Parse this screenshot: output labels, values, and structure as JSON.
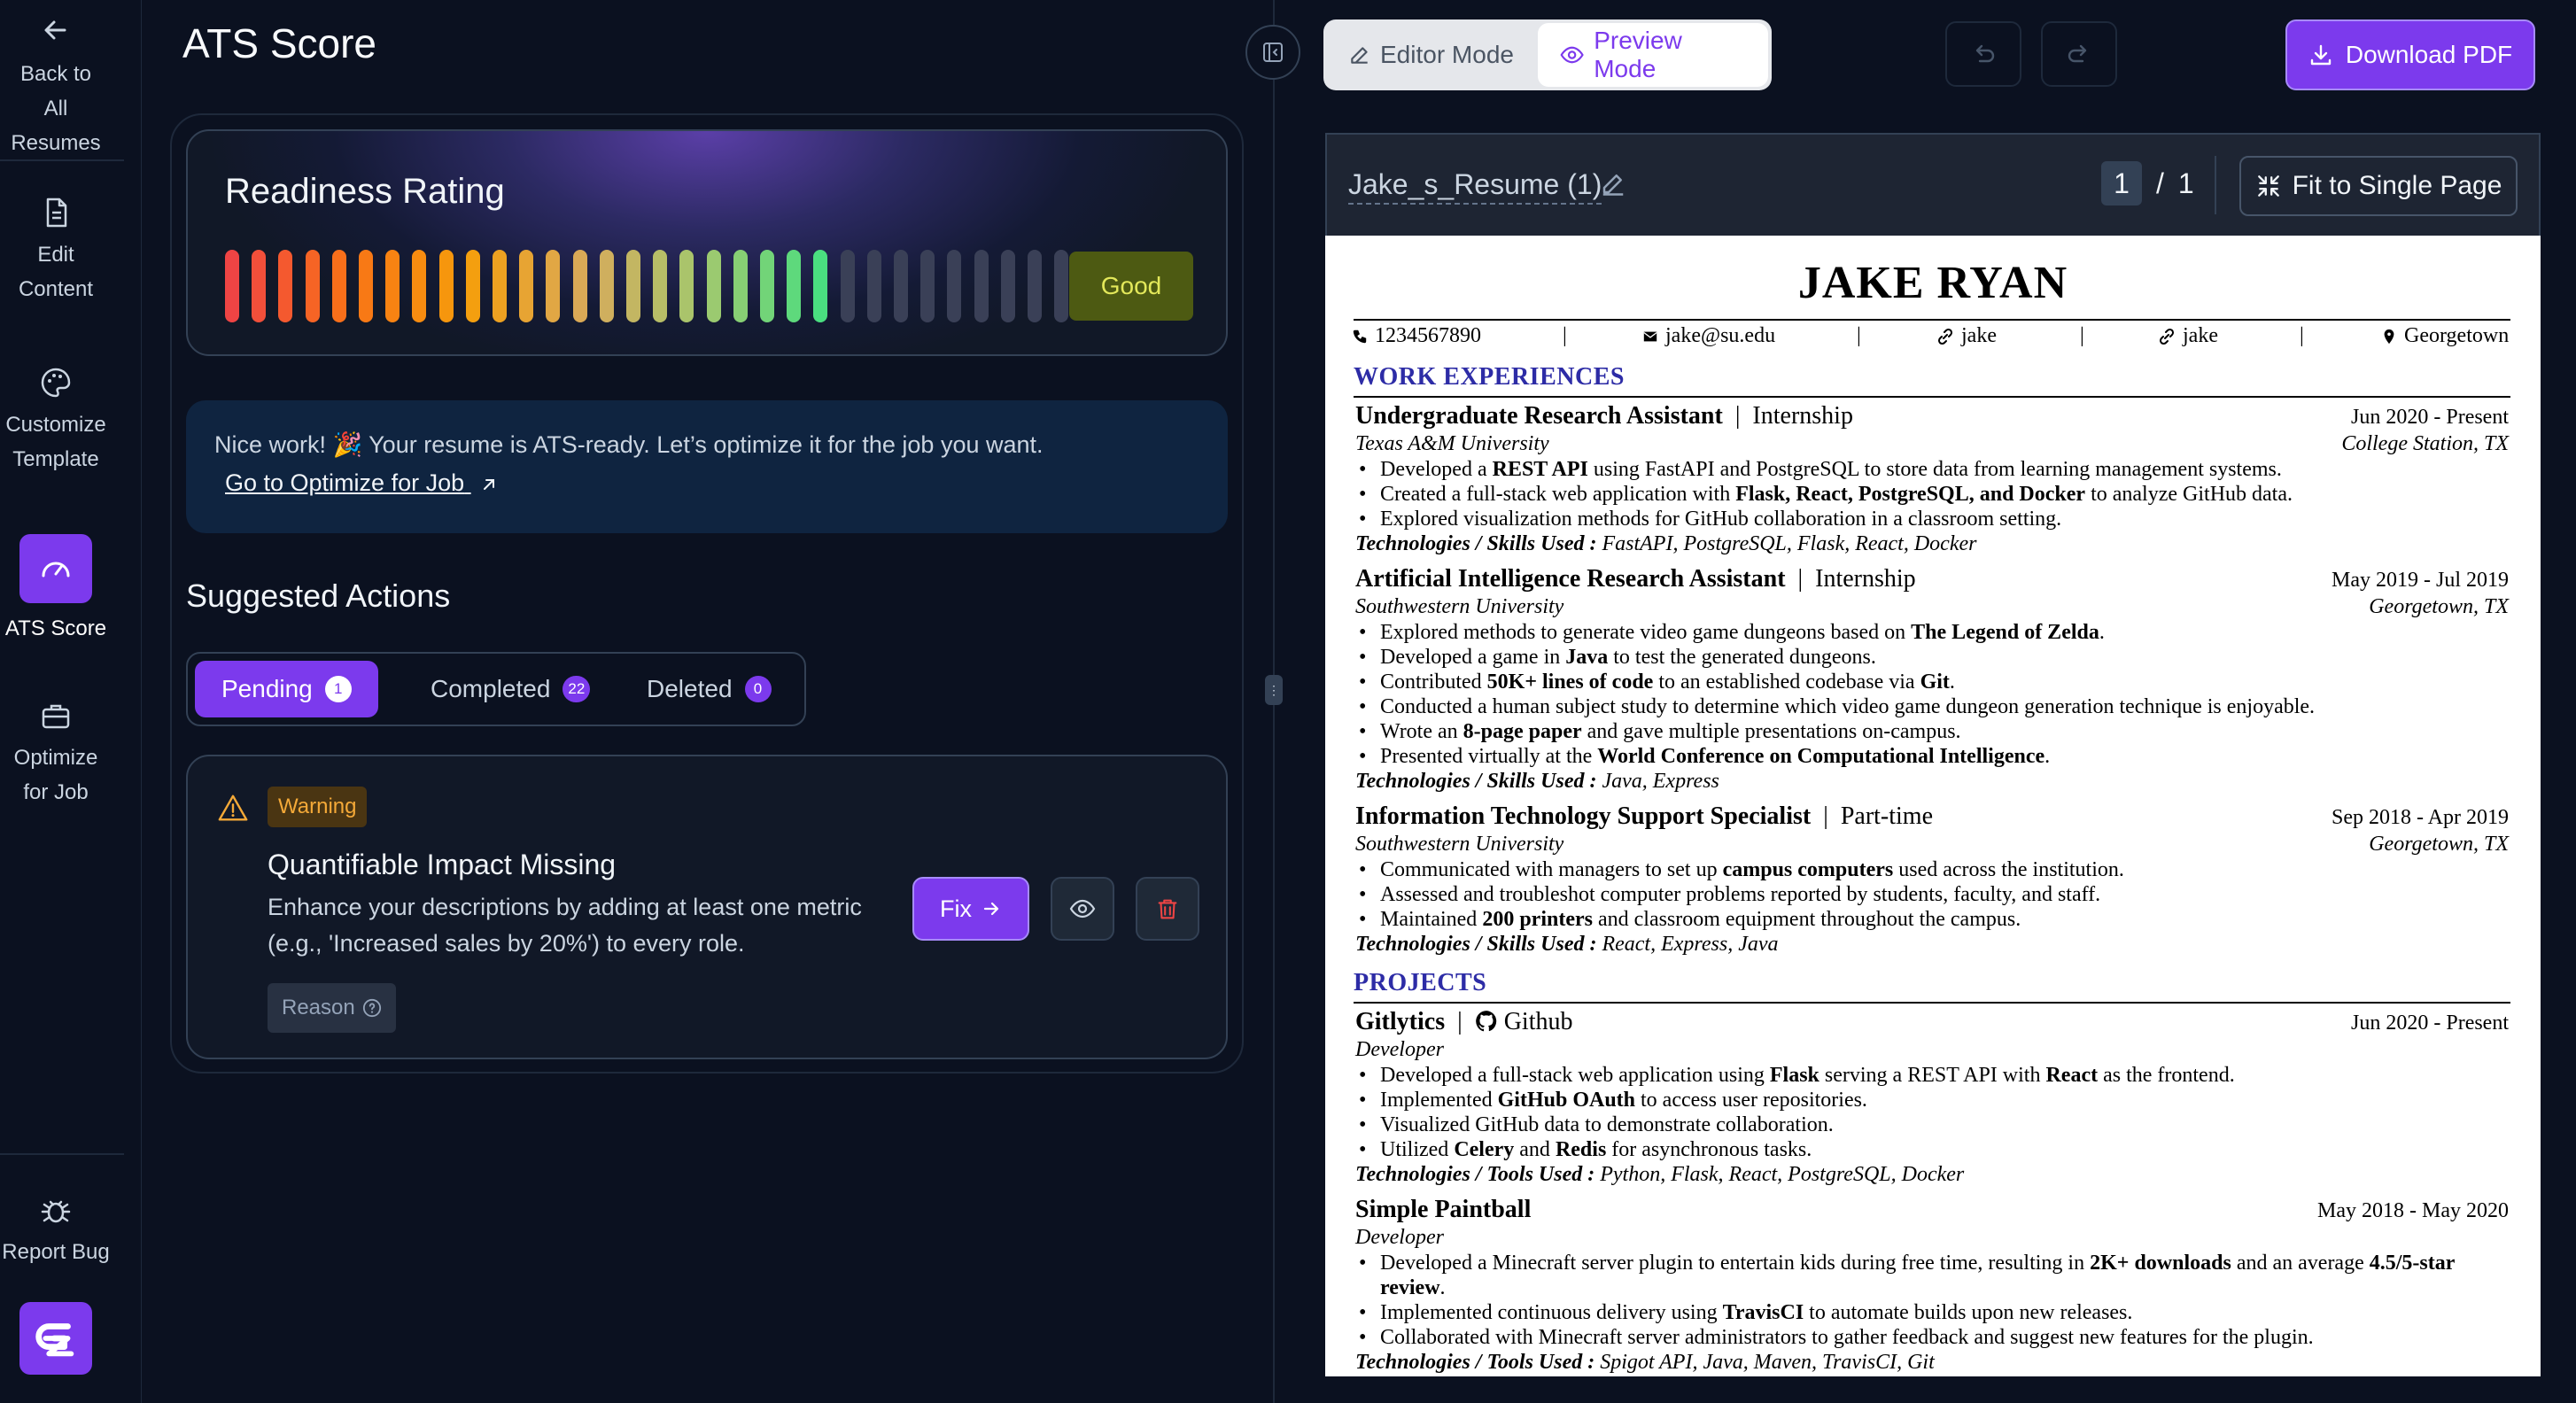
{
  "sidebar": {
    "back_line1": "Back to",
    "back_line2": "All Resumes",
    "edit_line1": "Edit",
    "edit_line2": "Content",
    "customize_line1": "Customize",
    "customize_line2": "Template",
    "ats": "ATS Score",
    "optimize_line1": "Optimize",
    "optimize_line2": "for Job",
    "report": "Report Bug",
    "logo": "Ꮚ"
  },
  "page_title": "ATS Score",
  "readiness": {
    "title": "Readiness Rating",
    "rating": "Good",
    "total_bars": 32,
    "filled_bars": 23
  },
  "info": {
    "message": "Nice work! 🎉 Your resume is ATS-ready. Let’s optimize it for the job you want.",
    "link": "Go to Optimize for Job"
  },
  "suggested": {
    "title": "Suggested Actions",
    "tabs": [
      {
        "label": "Pending",
        "count": "1"
      },
      {
        "label": "Completed",
        "count": "22"
      },
      {
        "label": "Deleted",
        "count": "0"
      }
    ],
    "item": {
      "badge": "Warning",
      "title": "Quantifiable Impact Missing",
      "desc1": "Enhance your descriptions by adding at least one metric",
      "desc2": "(e.g., 'Increased sales by 20%') to every role.",
      "reason": "Reason",
      "fix": "Fix"
    }
  },
  "toolbar": {
    "editor_mode": "Editor Mode",
    "preview_mode": "Preview Mode",
    "download": "Download PDF"
  },
  "doc": {
    "name": "Jake_s_Resume (1)",
    "page_current": "1",
    "page_sep": "/",
    "page_total": "1",
    "fit": "Fit to Single Page"
  },
  "resume": {
    "name": "JAKE RYAN",
    "phone": "1234567890",
    "email": "jake@su.edu",
    "link1": "jake",
    "link2": "jake",
    "location": "Georgetown",
    "sep": "|",
    "work_title": "WORK EXPERIENCES",
    "projects_title": "PROJECTS",
    "work": [
      {
        "title": "Undergraduate Research Assistant",
        "type": "Internship",
        "date": "Jun 2020 - Present",
        "org": "Texas A&M University",
        "loc": "College Station, TX",
        "bullets": [
          [
            "Developed a ",
            "REST API",
            " using FastAPI and PostgreSQL to store data from learning management systems."
          ],
          [
            "Created a full-stack web application with ",
            "Flask, React, PostgreSQL, and Docker",
            " to analyze GitHub data."
          ],
          [
            "Explored visualization methods for GitHub collaboration in a classroom setting.",
            "",
            ""
          ]
        ],
        "tech_label": "Technologies / Skills Used :",
        "tech": "FastAPI, PostgreSQL, Flask, React, Docker"
      },
      {
        "title": "Artificial Intelligence Research Assistant",
        "type": "Internship",
        "date": "May 2019 - Jul 2019",
        "org": "Southwestern University",
        "loc": "Georgetown, TX",
        "bullets": [
          [
            "Explored methods to generate video game dungeons based on ",
            "The Legend of Zelda",
            "."
          ],
          [
            "Developed a game in ",
            "Java",
            " to test the generated dungeons."
          ],
          [
            "Contributed ",
            "50K+ lines of code",
            " to an established codebase via "
          ],
          [
            "Conducted a human subject study to determine which video game dungeon generation technique is enjoyable.",
            "",
            ""
          ],
          [
            "Wrote an ",
            "8-page paper",
            " and gave multiple presentations on-campus."
          ],
          [
            "Presented virtually at the ",
            "World Conference on Computational Intelligence",
            "."
          ]
        ],
        "git": "Git",
        "tech_label": "Technologies / Skills Used :",
        "tech": "Java, Express"
      },
      {
        "title": "Information Technology Support Specialist",
        "type": "Part-time",
        "date": "Sep 2018 - Apr 2019",
        "org": "Southwestern University",
        "loc": "Georgetown, TX",
        "bullets": [
          [
            "Communicated with managers to set up ",
            "campus computers",
            " used across the institution."
          ],
          [
            "Assessed and troubleshot computer problems reported by students, faculty, and staff.",
            "",
            ""
          ],
          [
            "Maintained ",
            "200 printers",
            " and classroom equipment throughout the campus."
          ]
        ],
        "tech_label": "Technologies / Skills Used :",
        "tech": "React, Express, Java"
      }
    ],
    "projects": [
      {
        "title": "Gitlytics",
        "link": "Github",
        "date": "Jun 2020 - Present",
        "role": "Developer",
        "bullets": [
          [
            "Developed a full-stack web application using ",
            "Flask",
            " serving a REST API with ",
            "React",
            " as the frontend."
          ],
          [
            "Implemented ",
            "GitHub OAuth",
            " to access user repositories.",
            "",
            ""
          ],
          [
            "Visualized GitHub data to demonstrate collaboration.",
            "",
            "",
            "",
            ""
          ],
          [
            "Utilized ",
            "Celery",
            " and ",
            "Redis",
            " for asynchronous tasks."
          ]
        ],
        "tech_label": "Technologies / Tools Used :",
        "tech": "Python, Flask, React, PostgreSQL, Docker"
      },
      {
        "title": "Simple Paintball",
        "date": "May 2018 - May 2020",
        "role": "Developer",
        "bullets": [
          [
            "Developed a Minecraft server plugin to entertain kids during free time, resulting in ",
            "2K+ downloads",
            " and an average ",
            "4.5/5-star",
            ""
          ],
          [
            "review",
            "."
          ],
          [
            "Implemented continuous delivery using ",
            "TravisCI",
            " to automate builds upon new releases."
          ],
          [
            "Collaborated with Minecraft server administrators to gather feedback and suggest new features for the plugin.",
            "",
            ""
          ]
        ],
        "tech_label": "Technologies / Tools Used :",
        "tech": "Spigot API, Java, Maven, TravisCI, Git"
      }
    ]
  },
  "colors": {
    "accent": "#7c3aed",
    "background": "#0b1120",
    "section_blue": "#2d2ca6",
    "warning": "#f4a938",
    "danger": "#ef4444"
  }
}
